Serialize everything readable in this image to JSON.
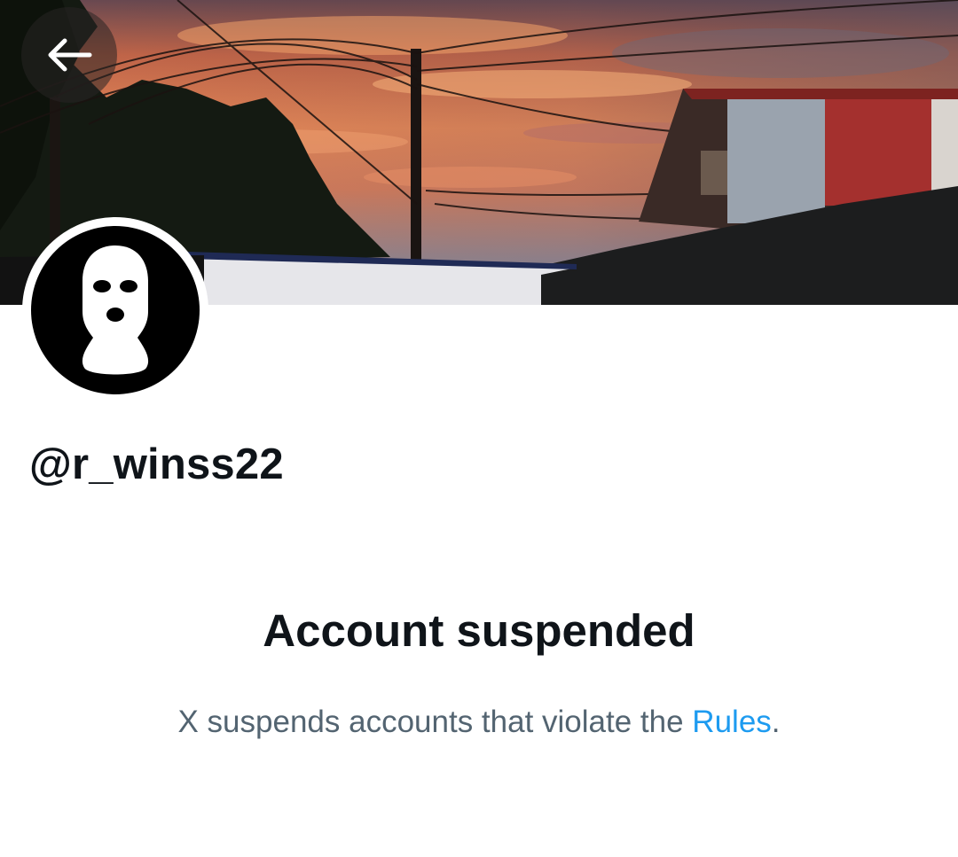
{
  "header": {
    "back_icon": "arrow-left-icon"
  },
  "banner": {
    "description_icon": "banner-image"
  },
  "profile": {
    "avatar_icon": "ski-mask-avatar",
    "handle": "@r_winss22"
  },
  "suspension": {
    "title": "Account suspended",
    "message_prefix": "X suspends accounts that violate the ",
    "rules_link": "Rules",
    "message_suffix": "."
  },
  "colors": {
    "text_primary": "#0f1419",
    "text_secondary": "#536471",
    "link": "#1d9bf0",
    "background": "#ffffff"
  }
}
